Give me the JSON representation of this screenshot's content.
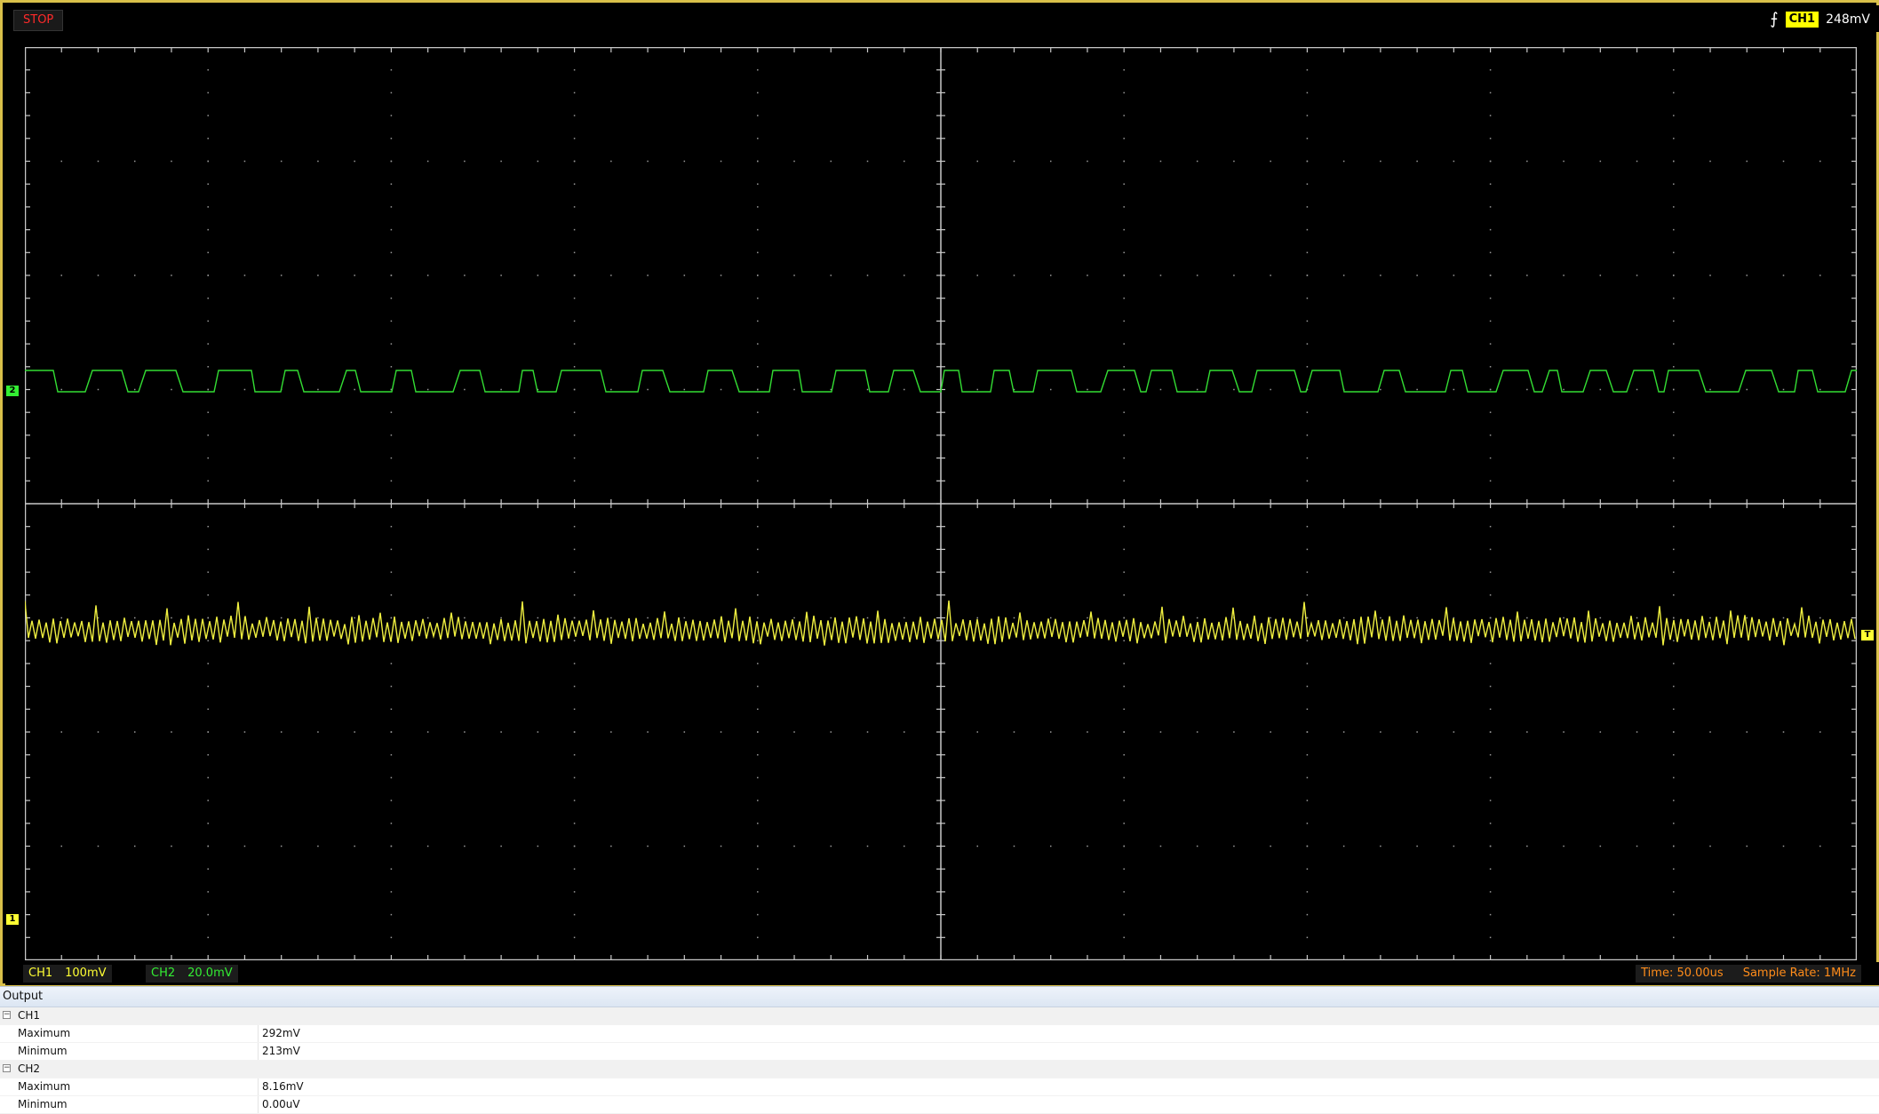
{
  "status": {
    "run_state": "STOP"
  },
  "trigger": {
    "icon": "rising-edge-trigger-icon",
    "channel": "CH1",
    "level": "248mV"
  },
  "channels": {
    "ch1": {
      "name": "CH1",
      "coupling_icon": ":::: ",
      "scale": "100mV",
      "color": "#ffff33",
      "marker": "1"
    },
    "ch2": {
      "name": "CH2",
      "coupling_icon": "::::",
      "scale": "20.0mV",
      "color": "#33ee33",
      "marker": "2"
    }
  },
  "timebase": {
    "time_label": "Time: 50.00us",
    "sample_rate_label": "Sample Rate: 1MHz"
  },
  "trigger_marker": "T",
  "output": {
    "title": "Output",
    "groups": [
      {
        "name": "CH1",
        "rows": [
          {
            "label": "Maximum",
            "value": "292mV"
          },
          {
            "label": "Minimum",
            "value": "213mV"
          }
        ]
      },
      {
        "name": "CH2",
        "rows": [
          {
            "label": "Maximum",
            "value": "8.16mV"
          },
          {
            "label": "Minimum",
            "value": "0.00uV"
          }
        ]
      }
    ]
  },
  "colors": {
    "frame": "#d9c04a",
    "grid": "#bcbcbc",
    "stop": "#ff2a2a",
    "time_info": "#ff8c1a"
  }
}
